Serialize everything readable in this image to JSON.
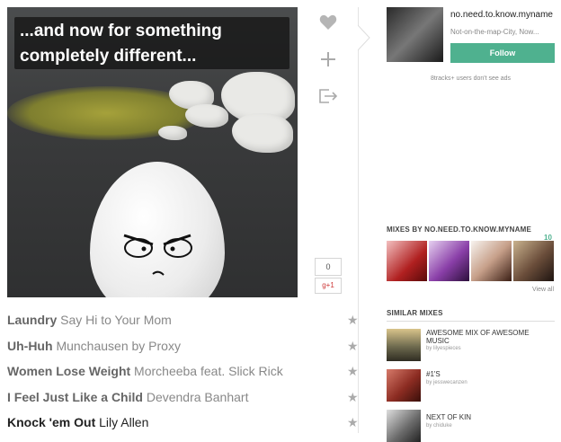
{
  "cover": {
    "caption_line1": "...and now for something",
    "caption_line2": "completely different..."
  },
  "actions": {
    "like_icon": "heart-icon",
    "add_icon": "plus-icon",
    "share_icon": "share-icon",
    "count": "0",
    "gplus": "g+1"
  },
  "profile": {
    "username": "no.need.to.know.myname",
    "location": "Not-on-the-map-City, Now...",
    "follow_label": "Follow",
    "ads_note": "8tracks+ users don't see ads"
  },
  "mixes_by": {
    "heading": "MIXES BY NO.NEED.TO.KNOW.MYNAME",
    "count": "10",
    "view_all": "View all"
  },
  "similar": {
    "heading": "SIMILAR MIXES",
    "items": [
      {
        "title": "AWESOME MIX OF AWESOME MUSIC",
        "by": "by lilyespieces"
      },
      {
        "title": "#1'S",
        "by": "by jesswecanzen"
      },
      {
        "title": "NEXT OF KIN",
        "by": "by chiduke"
      }
    ]
  },
  "tracks": [
    {
      "title": "Laundry",
      "artist": "Say Hi to Your Mom"
    },
    {
      "title": "Uh-Huh",
      "artist": "Munchausen by Proxy"
    },
    {
      "title": "Women Lose Weight",
      "artist": "Morcheeba feat. Slick Rick"
    },
    {
      "title": "I Feel Just Like a Child",
      "artist": "Devendra Banhart"
    },
    {
      "title": "Knock 'em Out",
      "artist": "Lily Allen"
    }
  ],
  "colors": {
    "follow": "#4fb18f",
    "accent_count": "#4fb18f"
  }
}
